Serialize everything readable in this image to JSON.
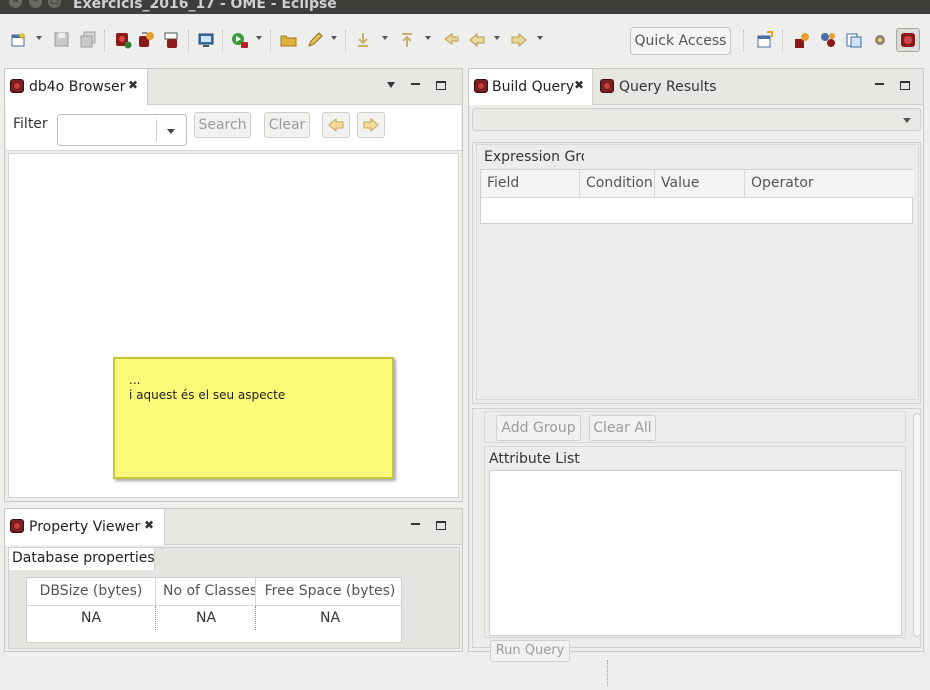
{
  "window": {
    "title": "Exercicis_2016_17 - OME - Eclipse"
  },
  "toolbar": {
    "quick_access": "Quick Access"
  },
  "db4o_browser": {
    "tab_label": "db4o Browser",
    "filter_label": "Filter",
    "filter_value": "",
    "search_label": "Search",
    "clear_label": "Clear"
  },
  "note": {
    "line1": "...",
    "line2": "i aquest és el seu aspecte"
  },
  "property_viewer": {
    "tab_label": "Property Viewer",
    "subtab_label": "Database properties",
    "columns": [
      "DBSize (bytes)",
      "No of Classes",
      "Free Space (bytes)"
    ],
    "values": [
      "NA",
      "NA",
      "NA"
    ]
  },
  "build_query": {
    "tab_label": "Build Query",
    "results_tab_label": "Query Results",
    "expression_group_label": "Expression Group",
    "columns": [
      "Field",
      "Condition",
      "Value",
      "Operator"
    ],
    "add_group_label": "Add Group",
    "clear_all_label": "Clear All",
    "attribute_list_label": "Attribute List",
    "run_query_label": "Run Query"
  },
  "colors": {
    "note_bg": "#fbfa78",
    "note_border": "#c7c43a",
    "title_bar": "#3e3d39"
  }
}
